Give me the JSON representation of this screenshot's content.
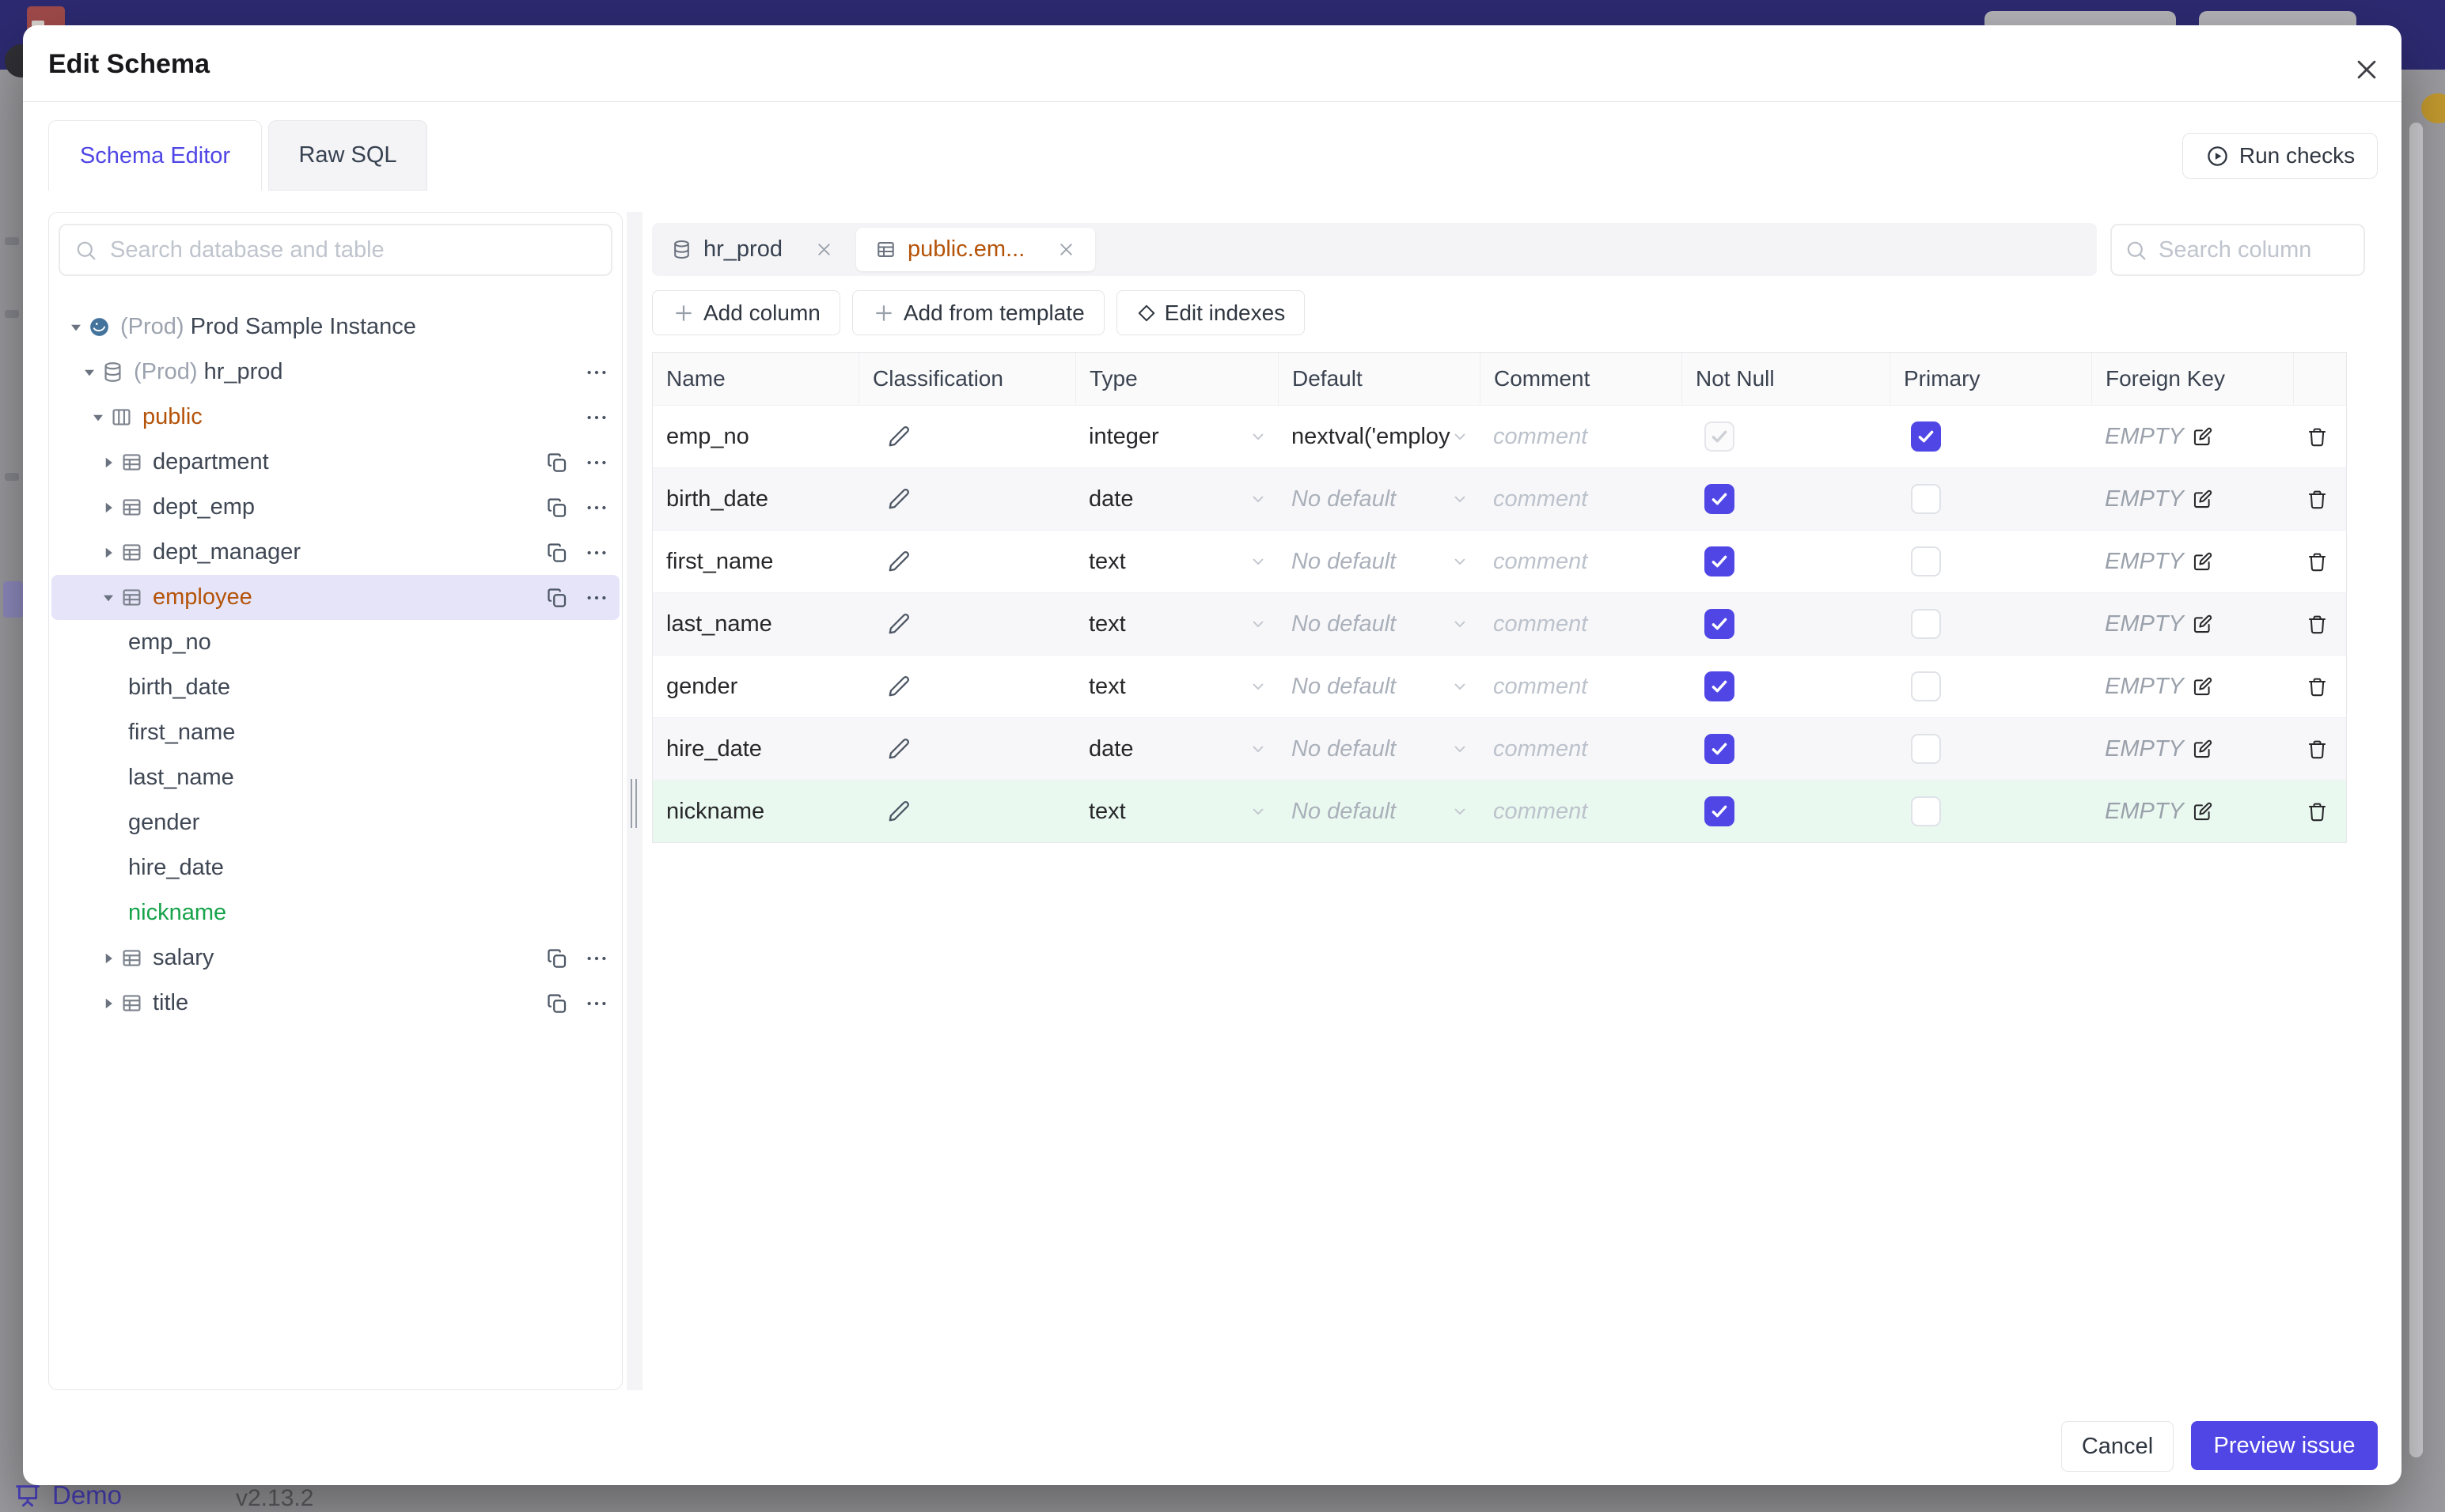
{
  "modal": {
    "title": "Edit Schema",
    "tabs": [
      {
        "label": "Schema Editor",
        "active": true
      },
      {
        "label": "Raw SQL",
        "active": false
      }
    ],
    "run_checks_label": "Run checks",
    "footer": {
      "cancel_label": "Cancel",
      "preview_label": "Preview issue"
    }
  },
  "sidebar": {
    "search_placeholder": "Search database and table",
    "tree": [
      {
        "level": 0,
        "caret": "down",
        "icon": "postgres",
        "prefix": "(Prod)",
        "label": "Prod Sample Instance"
      },
      {
        "level": 1,
        "caret": "down",
        "icon": "database",
        "prefix": "(Prod)",
        "label": "hr_prod",
        "menu": true
      },
      {
        "level": 2,
        "caret": "down",
        "icon": "schema",
        "label": "public",
        "color": "orange",
        "menu": true
      },
      {
        "level": 3,
        "caret": "right",
        "icon": "table",
        "label": "department",
        "copy": true,
        "menu": true
      },
      {
        "level": 3,
        "caret": "right",
        "icon": "table",
        "label": "dept_emp",
        "copy": true,
        "menu": true
      },
      {
        "level": 3,
        "caret": "right",
        "icon": "table",
        "label": "dept_manager",
        "copy": true,
        "menu": true
      },
      {
        "level": 3,
        "caret": "down",
        "icon": "table",
        "label": "employee",
        "color": "orange",
        "selected": true,
        "copy": true,
        "menu": true
      },
      {
        "level": 4,
        "label": "emp_no"
      },
      {
        "level": 4,
        "label": "birth_date"
      },
      {
        "level": 4,
        "label": "first_name"
      },
      {
        "level": 4,
        "label": "last_name"
      },
      {
        "level": 4,
        "label": "gender"
      },
      {
        "level": 4,
        "label": "hire_date"
      },
      {
        "level": 4,
        "label": "nickname",
        "color": "green"
      },
      {
        "level": 3,
        "caret": "right",
        "icon": "table",
        "label": "salary",
        "copy": true,
        "menu": true
      },
      {
        "level": 3,
        "caret": "right",
        "icon": "table",
        "label": "title",
        "copy": true,
        "menu": true
      }
    ]
  },
  "editor": {
    "open_tabs": [
      {
        "label": "hr_prod",
        "icon": "database",
        "active": false
      },
      {
        "label": "public.em...",
        "icon": "table",
        "active": true
      }
    ],
    "search_placeholder": "Search column",
    "action_buttons": [
      {
        "label": "Add column",
        "icon": "plus"
      },
      {
        "label": "Add from template",
        "icon": "plus"
      },
      {
        "label": "Edit indexes",
        "icon": "diamond"
      }
    ]
  },
  "table": {
    "headers": [
      "Name",
      "Classification",
      "Type",
      "Default",
      "Comment",
      "Not Null",
      "Primary",
      "Foreign Key"
    ],
    "comment_placeholder": "comment",
    "fk_empty_label": "EMPTY",
    "no_default_label": "No default",
    "rows": [
      {
        "name": "emp_no",
        "type": "integer",
        "default": "nextval('employ",
        "has_default_value": true,
        "not_null": true,
        "not_null_disabled": true,
        "primary": true,
        "variant": "plain"
      },
      {
        "name": "birth_date",
        "type": "date",
        "default": "No default",
        "has_default_value": false,
        "not_null": true,
        "primary": false,
        "variant": "zebra"
      },
      {
        "name": "first_name",
        "type": "text",
        "default": "No default",
        "has_default_value": false,
        "not_null": true,
        "primary": false,
        "variant": "plain"
      },
      {
        "name": "last_name",
        "type": "text",
        "default": "No default",
        "has_default_value": false,
        "not_null": true,
        "primary": false,
        "variant": "zebra"
      },
      {
        "name": "gender",
        "type": "text",
        "default": "No default",
        "has_default_value": false,
        "not_null": true,
        "primary": false,
        "variant": "plain"
      },
      {
        "name": "hire_date",
        "type": "date",
        "default": "No default",
        "has_default_value": false,
        "not_null": true,
        "primary": false,
        "variant": "zebra"
      },
      {
        "name": "nickname",
        "type": "text",
        "default": "No default",
        "has_default_value": false,
        "not_null": true,
        "primary": false,
        "variant": "newrow"
      }
    ]
  },
  "background": {
    "demo_label": "Demo",
    "version": "v2.13.2"
  },
  "colors": {
    "accent": "#4f46e5",
    "table_name_orange": "#b45309",
    "new_column_green": "#16a34a",
    "new_row_bg": "#e9f9f0",
    "selected_tree_bg": "#e6e4f8",
    "topbar_navy": "#2d2a72"
  }
}
